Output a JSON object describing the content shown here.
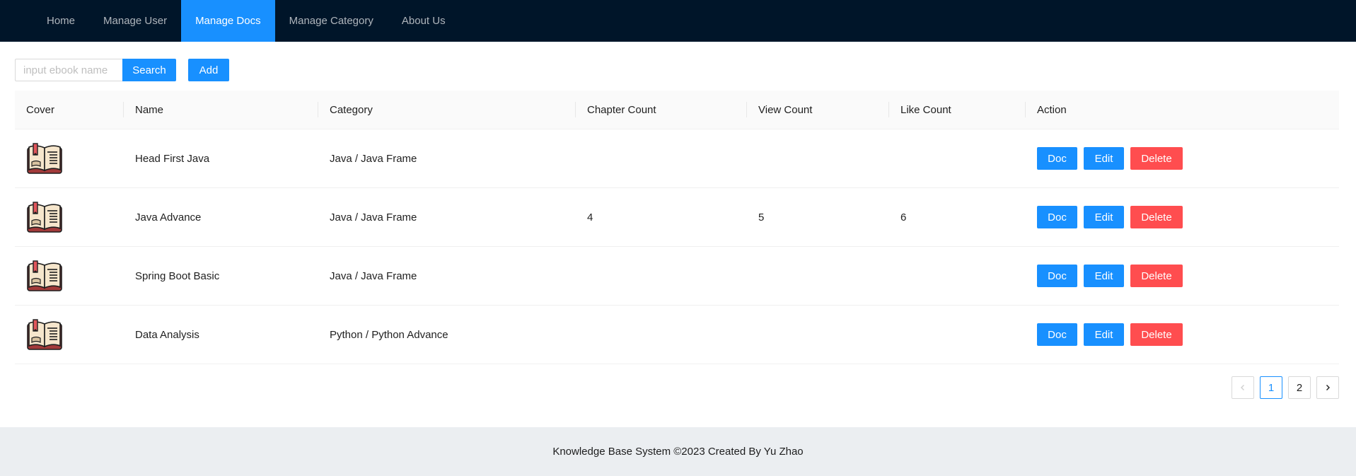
{
  "nav": {
    "items": [
      {
        "label": "Home"
      },
      {
        "label": "Manage User"
      },
      {
        "label": "Manage Docs"
      },
      {
        "label": "Manage Category"
      },
      {
        "label": "About Us"
      }
    ],
    "active": "Manage Docs"
  },
  "toolbar": {
    "search_placeholder": "input ebook name",
    "search_value": "",
    "search_label": "Search",
    "add_label": "Add"
  },
  "table": {
    "columns": [
      "Cover",
      "Name",
      "Category",
      "Chapter Count",
      "View Count",
      "Like Count",
      "Action"
    ],
    "rows": [
      {
        "cover": "book-cover-icon",
        "name": "Head First Java",
        "category": "Java / Java Frame",
        "chapter_count": "",
        "view_count": "",
        "like_count": ""
      },
      {
        "cover": "book-cover-icon",
        "name": "Java Advance",
        "category": "Java / Java Frame",
        "chapter_count": "4",
        "view_count": "5",
        "like_count": "6"
      },
      {
        "cover": "book-cover-icon",
        "name": "Spring Boot Basic",
        "category": "Java / Java Frame",
        "chapter_count": "",
        "view_count": "",
        "like_count": ""
      },
      {
        "cover": "book-cover-icon",
        "name": "Data Analysis",
        "category": "Python / Python Advance",
        "chapter_count": "",
        "view_count": "",
        "like_count": ""
      }
    ],
    "actions": {
      "doc": "Doc",
      "edit": "Edit",
      "delete": "Delete"
    }
  },
  "pagination": {
    "prev_icon": "chevron-left-icon",
    "next_icon": "chevron-right-icon",
    "pages": [
      "1",
      "2"
    ],
    "current": "1"
  },
  "footer": {
    "text": "Knowledge Base System ©2023 Created By Yu Zhao"
  },
  "colors": {
    "header_bg": "#001529",
    "primary": "#1890ff",
    "danger": "#ff4d4f",
    "footer_bg": "#ebeef1"
  }
}
